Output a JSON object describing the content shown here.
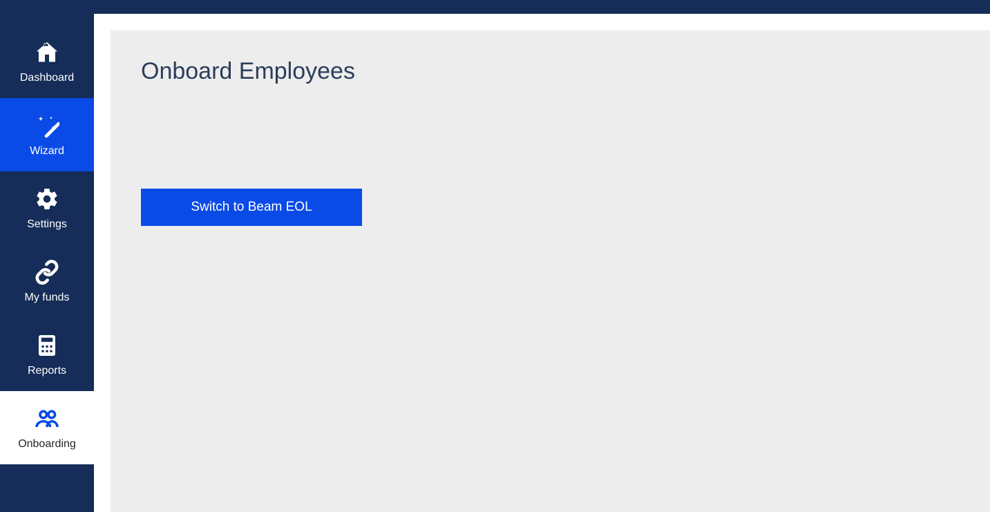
{
  "sidebar": {
    "items": [
      {
        "label": "Dashboard"
      },
      {
        "label": "Wizard"
      },
      {
        "label": "Settings"
      },
      {
        "label": "My funds"
      },
      {
        "label": "Reports"
      },
      {
        "label": "Onboarding"
      }
    ]
  },
  "main": {
    "title": "Onboard Employees",
    "button_label": "Switch to Beam EOL"
  }
}
